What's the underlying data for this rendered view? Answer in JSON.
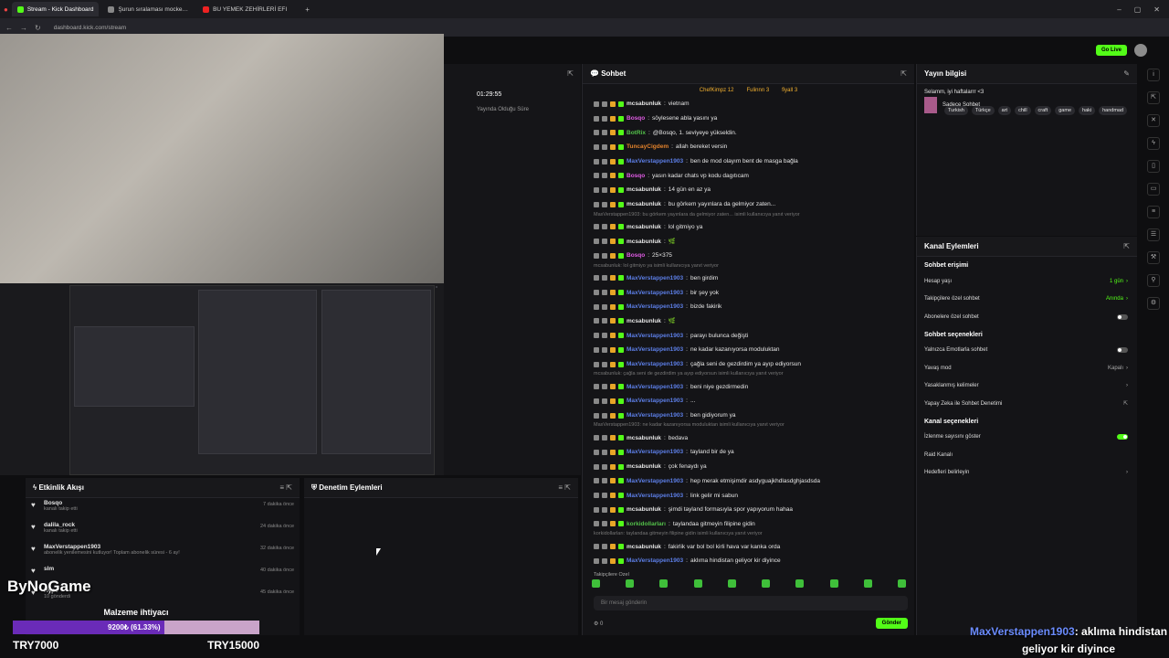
{
  "tabs": [
    {
      "label": "Stream - Kick Dashboard",
      "icon": "kick-icon"
    },
    {
      "label": "Şurun sıralaması mocke…",
      "icon": "page-icon"
    },
    {
      "label": "BU YEMEK ZEHİRLERİ EFI",
      "icon": "youtube-icon"
    }
  ],
  "url": "dashboard.kick.com/stream",
  "topbar": {
    "go_live": "Go Live"
  },
  "stream_info": {
    "timer": "01:29:55",
    "subtitle": "Yayında Olduğu Süre"
  },
  "chat": {
    "title": "Sohbet",
    "pinned": [
      "ChefKimpz 12",
      "Fulinnn 3",
      "fiyall 3"
    ],
    "lines": [
      {
        "type": "msg",
        "user": "mcsabunluk",
        "color": "w",
        "text": "vietnam"
      },
      {
        "type": "msg",
        "user": "Bosqo",
        "color": "p",
        "text": "söylesene abla yasını ya"
      },
      {
        "type": "msg",
        "user": "BotRix",
        "color": "gr",
        "text": "@Bosqo, 1. seviyeye yükseldin."
      },
      {
        "type": "msg",
        "user": "TuncayCigdem",
        "color": "o",
        "text": "allah bereket versin"
      },
      {
        "type": "msg",
        "user": "MaxVerstappen1903",
        "color": "b",
        "text": "ben de mod olayım bent de masga bağla"
      },
      {
        "type": "msg",
        "user": "Bosqo",
        "color": "p",
        "text": "yasın kadar chats vp kodu dagıtıcam"
      },
      {
        "type": "msg",
        "user": "mcsabunluk",
        "color": "w",
        "text": "14 gün en az ya"
      },
      {
        "type": "msg",
        "user": "mcsabunluk",
        "color": "w",
        "text": "bu görkem yayınlara da gelmiyor zaten..."
      },
      {
        "type": "sys",
        "text": "MaxVerstappen1903: bu görkem yayınlara da gelmiyor zaten... isimli kullanıcıya yanıt veriyor"
      },
      {
        "type": "msg",
        "user": "mcsabunluk",
        "color": "w",
        "text": "lol gitmiyo ya"
      },
      {
        "type": "msg",
        "user": "mcsabunluk",
        "color": "w",
        "text": "🌿"
      },
      {
        "type": "msg",
        "user": "Bosqo",
        "color": "p",
        "text": "25×375"
      },
      {
        "type": "sys",
        "text": "mcsabunluk: lol gitmiyo ya isimli kullanıcıya yanıt veriyor"
      },
      {
        "type": "msg",
        "user": "MaxVerstappen1903",
        "color": "b",
        "text": "ben girdim"
      },
      {
        "type": "msg",
        "user": "MaxVerstappen1903",
        "color": "b",
        "text": "bir şey yok"
      },
      {
        "type": "msg",
        "user": "MaxVerstappen1903",
        "color": "b",
        "text": "bizde fakirik"
      },
      {
        "type": "msg",
        "user": "mcsabunluk",
        "color": "w",
        "text": "🌿"
      },
      {
        "type": "msg",
        "user": "MaxVerstappen1903",
        "color": "b",
        "text": "parayı bulunca değişti"
      },
      {
        "type": "msg",
        "user": "MaxVerstappen1903",
        "color": "b",
        "text": "ne kadar kazanıyorsa moduluktan"
      },
      {
        "type": "msg",
        "user": "MaxVerstappen1903",
        "color": "b",
        "text": "çağla seni de gezdirdim ya ayıp ediyorsun"
      },
      {
        "type": "sys",
        "text": "mcsabunluk: çağla seni de gezdirdim ya ayıp ediyorsun isimli kullanıcıya yanıt veriyor"
      },
      {
        "type": "msg",
        "user": "MaxVerstappen1903",
        "color": "b",
        "text": "beni niye gezdirmedin"
      },
      {
        "type": "msg",
        "user": "MaxVerstappen1903",
        "color": "b",
        "text": "..."
      },
      {
        "type": "msg",
        "user": "MaxVerstappen1903",
        "color": "b",
        "text": "ben gidiyorum ya"
      },
      {
        "type": "sys",
        "text": "MaxVerstappen1903: ne kadar kazanıyorsa moduluktan isimli kullanıcıya yanıt veriyor"
      },
      {
        "type": "msg",
        "user": "mcsabunluk",
        "color": "w",
        "text": "bedava"
      },
      {
        "type": "msg",
        "user": "MaxVerstappen1903",
        "color": "b",
        "text": "tayland bir de ya"
      },
      {
        "type": "msg",
        "user": "mcsabunluk",
        "color": "w",
        "text": "çok fenaydı ya"
      },
      {
        "type": "msg",
        "user": "MaxVerstappen1903",
        "color": "b",
        "text": "hep merak etmişimdir asdyguajkhdlasdghjasdsda"
      },
      {
        "type": "msg",
        "user": "MaxVerstappen1903",
        "color": "b",
        "text": "link gelir mi sabun"
      },
      {
        "type": "msg",
        "user": "mcsabunluk",
        "color": "w",
        "text": "şimdi tayland formasıyla spor yapıyorum hahaa"
      },
      {
        "type": "msg",
        "user": "korkidollarları",
        "color": "gr",
        "text": "taylandaa gitmeyin filipine gidin"
      },
      {
        "type": "sys",
        "text": "korkidollarları: taylandaa gitmeyin filipine gidin isimli kullanıcıya yanıt veriyor"
      },
      {
        "type": "msg",
        "user": "mcsabunluk",
        "color": "w",
        "text": "fakirlik var bol bol kirli hava var kanka orda"
      },
      {
        "type": "msg",
        "user": "MaxVerstappen1903",
        "color": "b",
        "text": "aklıma hindistan geliyor kir diyince"
      }
    ],
    "followers_only": "Takipçilere Özel",
    "placeholder": "Bir mesaj gönderin",
    "send": "Gönder",
    "counter": "0"
  },
  "info": {
    "title": "Yayın bilgisi",
    "stream_title": "Selamm, iyi haftalarrr <3",
    "category": "Sadece Sohbet",
    "tags": [
      "Turkish",
      "Türkçe",
      "art",
      "chill",
      "craft",
      "game",
      "haki",
      "handmad"
    ]
  },
  "mod": {
    "title": "Kanal Eylemleri",
    "s1": "Sohbet erişimi",
    "r1": {
      "label": "Hesap yaşı",
      "value": "1 gün"
    },
    "r2": {
      "label": "Takipçilere özel sohbet",
      "value": "Anında"
    },
    "r3": {
      "label": "Abonelere özel sohbet"
    },
    "s2": "Sohbet seçenekleri",
    "r4": {
      "label": "Yalnızca Emotlarla sohbet"
    },
    "r5": {
      "label": "Yavaş mod",
      "value": "Kapalı"
    },
    "r6": {
      "label": "Yasaklanmış kelimeler"
    },
    "r7": {
      "label": "Yapay Zeka ile Sohbet Denetimi"
    },
    "s3": "Kanal seçenekleri",
    "r8": {
      "label": "İzlenme sayısını göster"
    },
    "r9": {
      "label": "Raid Kanalı"
    },
    "r10": {
      "label": "Hedefleri belirleyin"
    }
  },
  "activity": {
    "title": "Etkinlik Akışı",
    "items": [
      {
        "name": "Bosqo",
        "sub": "kanalı takip etti",
        "time": "7 dakika önce"
      },
      {
        "name": "dalila_rock",
        "sub": "kanalı takip etti",
        "time": "24 dakika önce"
      },
      {
        "name": "MaxVerstappen1903",
        "sub": "abonelik yenilemesini kutluyor! Toplam abonelik süresi - 6 ay!",
        "time": "32 dakika önce"
      },
      {
        "name": "slm",
        "sub": "",
        "time": "40 dakika önce"
      },
      {
        "name": "Hype",
        "sub": "10 gönderdi",
        "time": "45 dakika önce"
      }
    ]
  },
  "modactions": {
    "title": "Denetim Eylemleri"
  },
  "overlay": {
    "logo": "ByNoGame",
    "goal_title": "Malzeme ihtiyacı",
    "goal_text": "9200₺ (61.33%)",
    "goal_fraction": 0.6133,
    "goal_min": "TRY7000",
    "goal_max": "TRY15000",
    "chat_user": "MaxVerstappen1903",
    "chat_text": ": aklıma hindistan geliyor kir diyince"
  },
  "colors": {
    "accent": "#53fc18",
    "bg": "#0e0e10",
    "panel": "#141417",
    "username": "#5c7ee6"
  }
}
